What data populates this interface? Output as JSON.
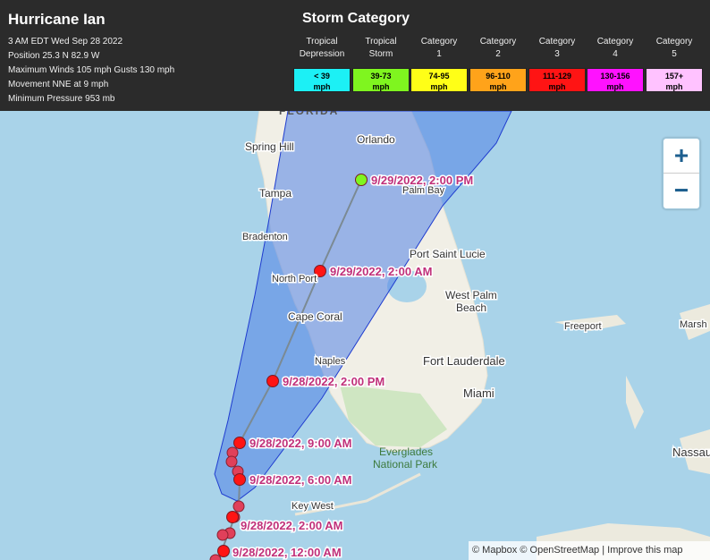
{
  "storm": {
    "name": "Hurricane Ian",
    "time": "3 AM EDT Wed Sep 28 2022",
    "position": "Position 25.3 N 82.9 W",
    "winds": "Maximum Winds 105 mph Gusts 130 mph",
    "movement": "Movement NNE at 9 mph",
    "pressure": "Minimum Pressure 953 mb"
  },
  "legend": {
    "title": "Storm Category",
    "categories": [
      {
        "line1": "Tropical",
        "line2": "Depression",
        "range1": "< 39",
        "range2": "mph",
        "color": "#1cf0f5"
      },
      {
        "line1": "Tropical",
        "line2": "Storm",
        "range1": "39-73",
        "range2": "mph",
        "color": "#7ff51f"
      },
      {
        "line1": "Category",
        "line2": "1",
        "range1": "74-95",
        "range2": "mph",
        "color": "#ffff17"
      },
      {
        "line1": "Category",
        "line2": "2",
        "range1": "96-110",
        "range2": "mph",
        "color": "#ffa31a"
      },
      {
        "line1": "Category",
        "line2": "3",
        "range1": "111-129",
        "range2": "mph",
        "color": "#ff1414"
      },
      {
        "line1": "Category",
        "line2": "4",
        "range1": "130-156",
        "range2": "mph",
        "color": "#ff12ff"
      },
      {
        "line1": "Category",
        "line2": "5",
        "range1": "157+",
        "range2": "mph",
        "color": "#ffc2ff"
      }
    ]
  },
  "map": {
    "state_label": "FLORIDA",
    "cities": [
      "Spring Hill",
      "Orlando",
      "Tampa",
      "Palm Bay",
      "Bradenton",
      "Port Saint Lucie",
      "North Port",
      "West Palm",
      "Beach",
      "Cape Coral",
      "Naples",
      "Fort Lauderdale",
      "Miami",
      "Key West",
      "Freeport",
      "Marsh",
      "Nassau"
    ],
    "park_label": [
      "Everglades",
      "National Park"
    ],
    "forecast_points": [
      {
        "label": "9/29/2022, 2:00 PM",
        "category": "Tropical Storm"
      },
      {
        "label": "9/29/2022, 2:00 AM",
        "category": "Category 3"
      },
      {
        "label": "9/28/2022, 2:00 PM",
        "category": "Category 3"
      },
      {
        "label": "9/28/2022, 9:00 AM",
        "category": "Category 3"
      },
      {
        "label": "9/28/2022, 6:00 AM",
        "category": "Category 3"
      },
      {
        "label": "9/28/2022, 2:00 AM",
        "category": "Category 3"
      },
      {
        "label": "9/28/2022, 12:00 AM",
        "category": "Category 3"
      }
    ],
    "cone_color": "#5f8fe8",
    "track_color": "#7b8a93"
  },
  "zoom": {
    "in": "+",
    "out": "−"
  },
  "attribution": {
    "mapbox": "© Mapbox",
    "osm": "© OpenStreetMap",
    "sep": "|",
    "improve": "Improve this map"
  }
}
